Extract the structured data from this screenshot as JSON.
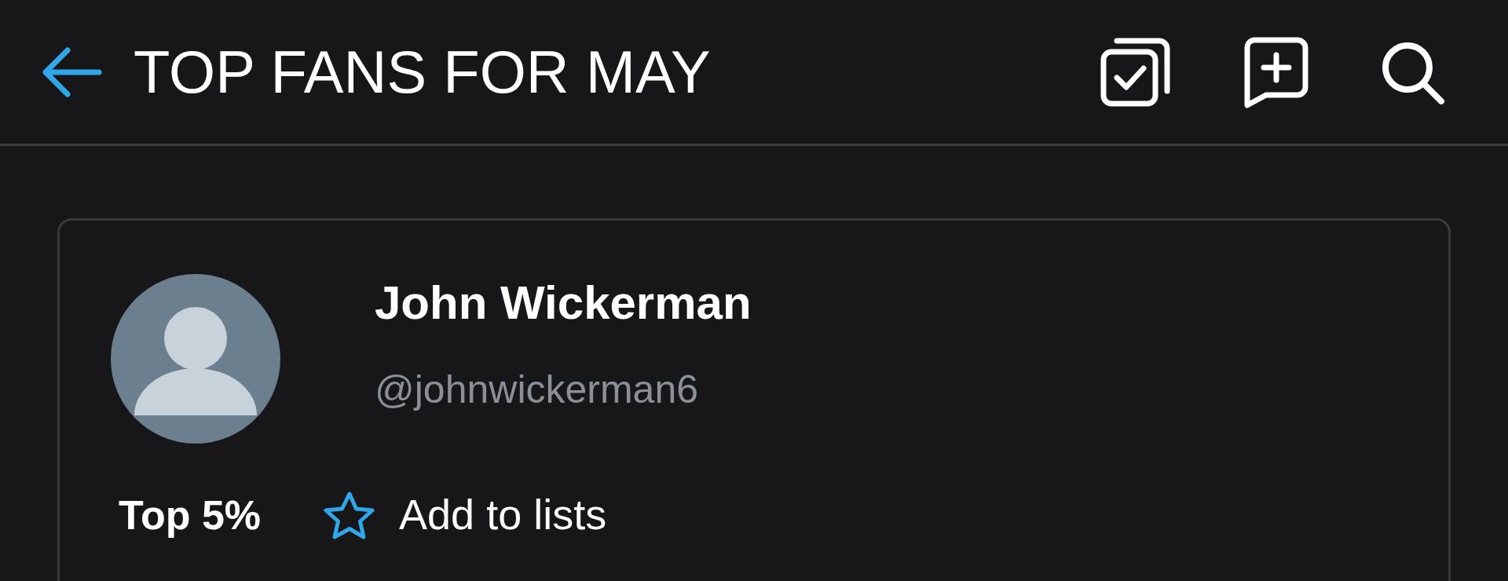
{
  "header": {
    "title": "TOP FANS FOR MAY"
  },
  "fan": {
    "name": "John Wickerman",
    "handle": "@johnwickerman6",
    "rank": "Top 5%",
    "list_action": "Add to lists"
  }
}
